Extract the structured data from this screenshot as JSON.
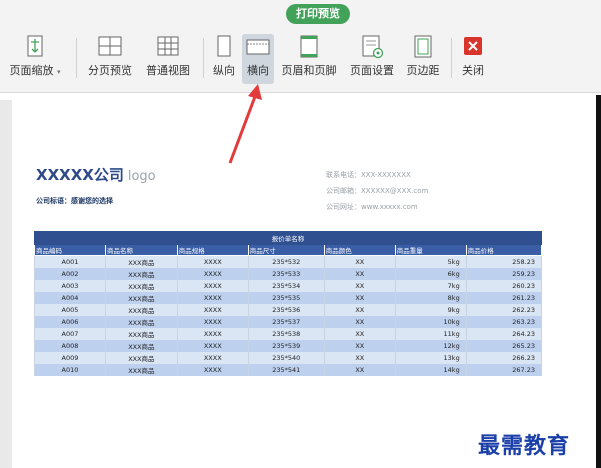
{
  "toolbar": {
    "tab_label": "打印预览",
    "items": [
      {
        "id": "page-zoom",
        "label": "页面缩放"
      },
      {
        "id": "page-break-preview",
        "label": "分页预览"
      },
      {
        "id": "normal-view",
        "label": "普通视图"
      },
      {
        "id": "portrait",
        "label": "纵向"
      },
      {
        "id": "landscape",
        "label": "横向"
      },
      {
        "id": "header-footer",
        "label": "页眉和页脚"
      },
      {
        "id": "page-setup",
        "label": "页面设置"
      },
      {
        "id": "margins",
        "label": "页边距"
      },
      {
        "id": "close",
        "label": "关闭"
      }
    ]
  },
  "preview": {
    "company": "XXXXX公司",
    "logo": "logo",
    "slogan": "公司标语：感谢您的选择",
    "contacts": [
      "联系电话：XXX-XXXXXXX",
      "公司邮箱：XXXXXX@XXX.com",
      "公司网址：www.xxxxx.com"
    ],
    "table": {
      "title": "报价单名称",
      "headers": [
        "商品编码",
        "商品名称",
        "商品规格",
        "商品尺寸",
        "商品颜色",
        "商品重量",
        "商品价格"
      ],
      "rows": [
        [
          "A001",
          "XXX商品",
          "XXXX",
          "235*532",
          "XX",
          "5kg",
          "258.23"
        ],
        [
          "A002",
          "XXX商品",
          "XXXX",
          "235*533",
          "XX",
          "6kg",
          "259.23"
        ],
        [
          "A003",
          "XXX商品",
          "XXXX",
          "235*534",
          "XX",
          "7kg",
          "260.23"
        ],
        [
          "A004",
          "XXX商品",
          "XXXX",
          "235*535",
          "XX",
          "8kg",
          "261.23"
        ],
        [
          "A005",
          "XXX商品",
          "XXXX",
          "235*536",
          "XX",
          "9kg",
          "262.23"
        ],
        [
          "A006",
          "XXX商品",
          "XXXX",
          "235*537",
          "XX",
          "10kg",
          "263.23"
        ],
        [
          "A007",
          "XXX商品",
          "XXXX",
          "235*538",
          "XX",
          "11kg",
          "264.23"
        ],
        [
          "A008",
          "XXX商品",
          "XXXX",
          "235*539",
          "XX",
          "12kg",
          "265.23"
        ],
        [
          "A009",
          "XXX商品",
          "XXXX",
          "235*540",
          "XX",
          "13kg",
          "266.23"
        ],
        [
          "A010",
          "XXX商品",
          "XXXX",
          "235*541",
          "XX",
          "14kg",
          "267.23"
        ]
      ]
    }
  },
  "watermark": "最需教育",
  "colors": {
    "accent": "#42a25a",
    "table_header": "#3a5ea6",
    "table_title": "#2f4f8f",
    "arrow": "#e23b3b",
    "close_red": "#d9342b"
  }
}
